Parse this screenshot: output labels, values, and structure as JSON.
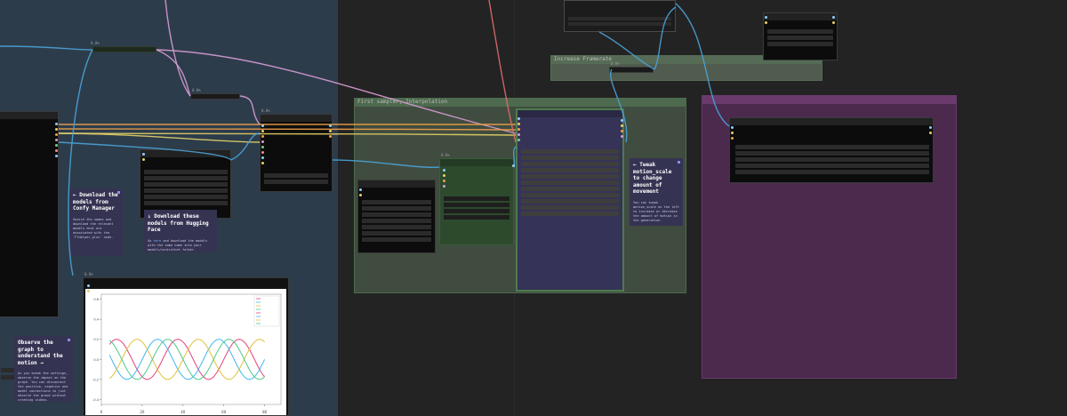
{
  "groups": {
    "first_sampler": {
      "title": "First sampler, Interpolation",
      "color": "#4e6a4e"
    },
    "increase_framerate": {
      "title": "Increase Framerate",
      "color": "#566b55"
    },
    "output_group": {
      "title": "",
      "color": "#4b2a4d"
    }
  },
  "nodes": {
    "top_center_tag": "",
    "node_a_tag": "0.0%",
    "node_b_tag": "0.0%",
    "node_c_tag": "0.0%",
    "node_d_tag": "0.0%",
    "node_e_tag": "0.0%",
    "graph_tag": "0.0%",
    "rife_tag": "0.0%"
  },
  "notes": {
    "confy_manager": {
      "title": "← Download the models from Confy Manager",
      "body": "Search the names and download the relevant models that are associated with the 'FlHelper_plus' node."
    },
    "hugging_face": {
      "title": "↓ Download these models from Hugging Face",
      "body_prefix": "Go ",
      "body_link": "here",
      "body_suffix": " and download the models with the same name into your models/controlnet folder."
    },
    "motion_scale": {
      "title": "← Tweak motion_scale to change amount of movement",
      "body": "You can tweak motion_scale on the left to increase or decrease the amount of motion in the generation."
    },
    "observe_graph": {
      "title": "Observe the graph to understand the motion →",
      "body": "As you tweak the settings, observe the impact on the graph. You can disconnect the positive, negative and model connections to just observe the graph without creating videos."
    }
  },
  "chart_data": {
    "type": "line",
    "title": "",
    "xlabel": "",
    "ylabel": "",
    "x_ticks": [
      "0",
      "20",
      "40",
      "60",
      "80"
    ],
    "y_ticks": [
      "0.6",
      "0.4",
      "0.2",
      "0.0",
      "-0.2",
      "-0.4"
    ],
    "xlim": [
      0,
      88
    ],
    "ylim": [
      -0.45,
      0.65
    ],
    "series": [
      {
        "name": "",
        "color": "#e5407a",
        "phase": 0.0
      },
      {
        "name": "",
        "color": "#3fb6f2",
        "phase": 2.09
      },
      {
        "name": "",
        "color": "#e0c23a",
        "phase": 4.19
      },
      {
        "name": "",
        "color": "#4cc98a",
        "phase": 1.05
      }
    ],
    "legend_entries": [
      "",
      "",
      "",
      "",
      "",
      "",
      "",
      ""
    ],
    "legend_position": "top-right",
    "amplitude": 0.2,
    "offset": 0.0,
    "period": 30
  },
  "colors": {
    "wire_orange": "#f0a24a",
    "wire_pink": "#d79cd6",
    "wire_blue": "#4aa3d8",
    "wire_red": "#e06c6c",
    "wire_yellow": "#e6d168"
  }
}
